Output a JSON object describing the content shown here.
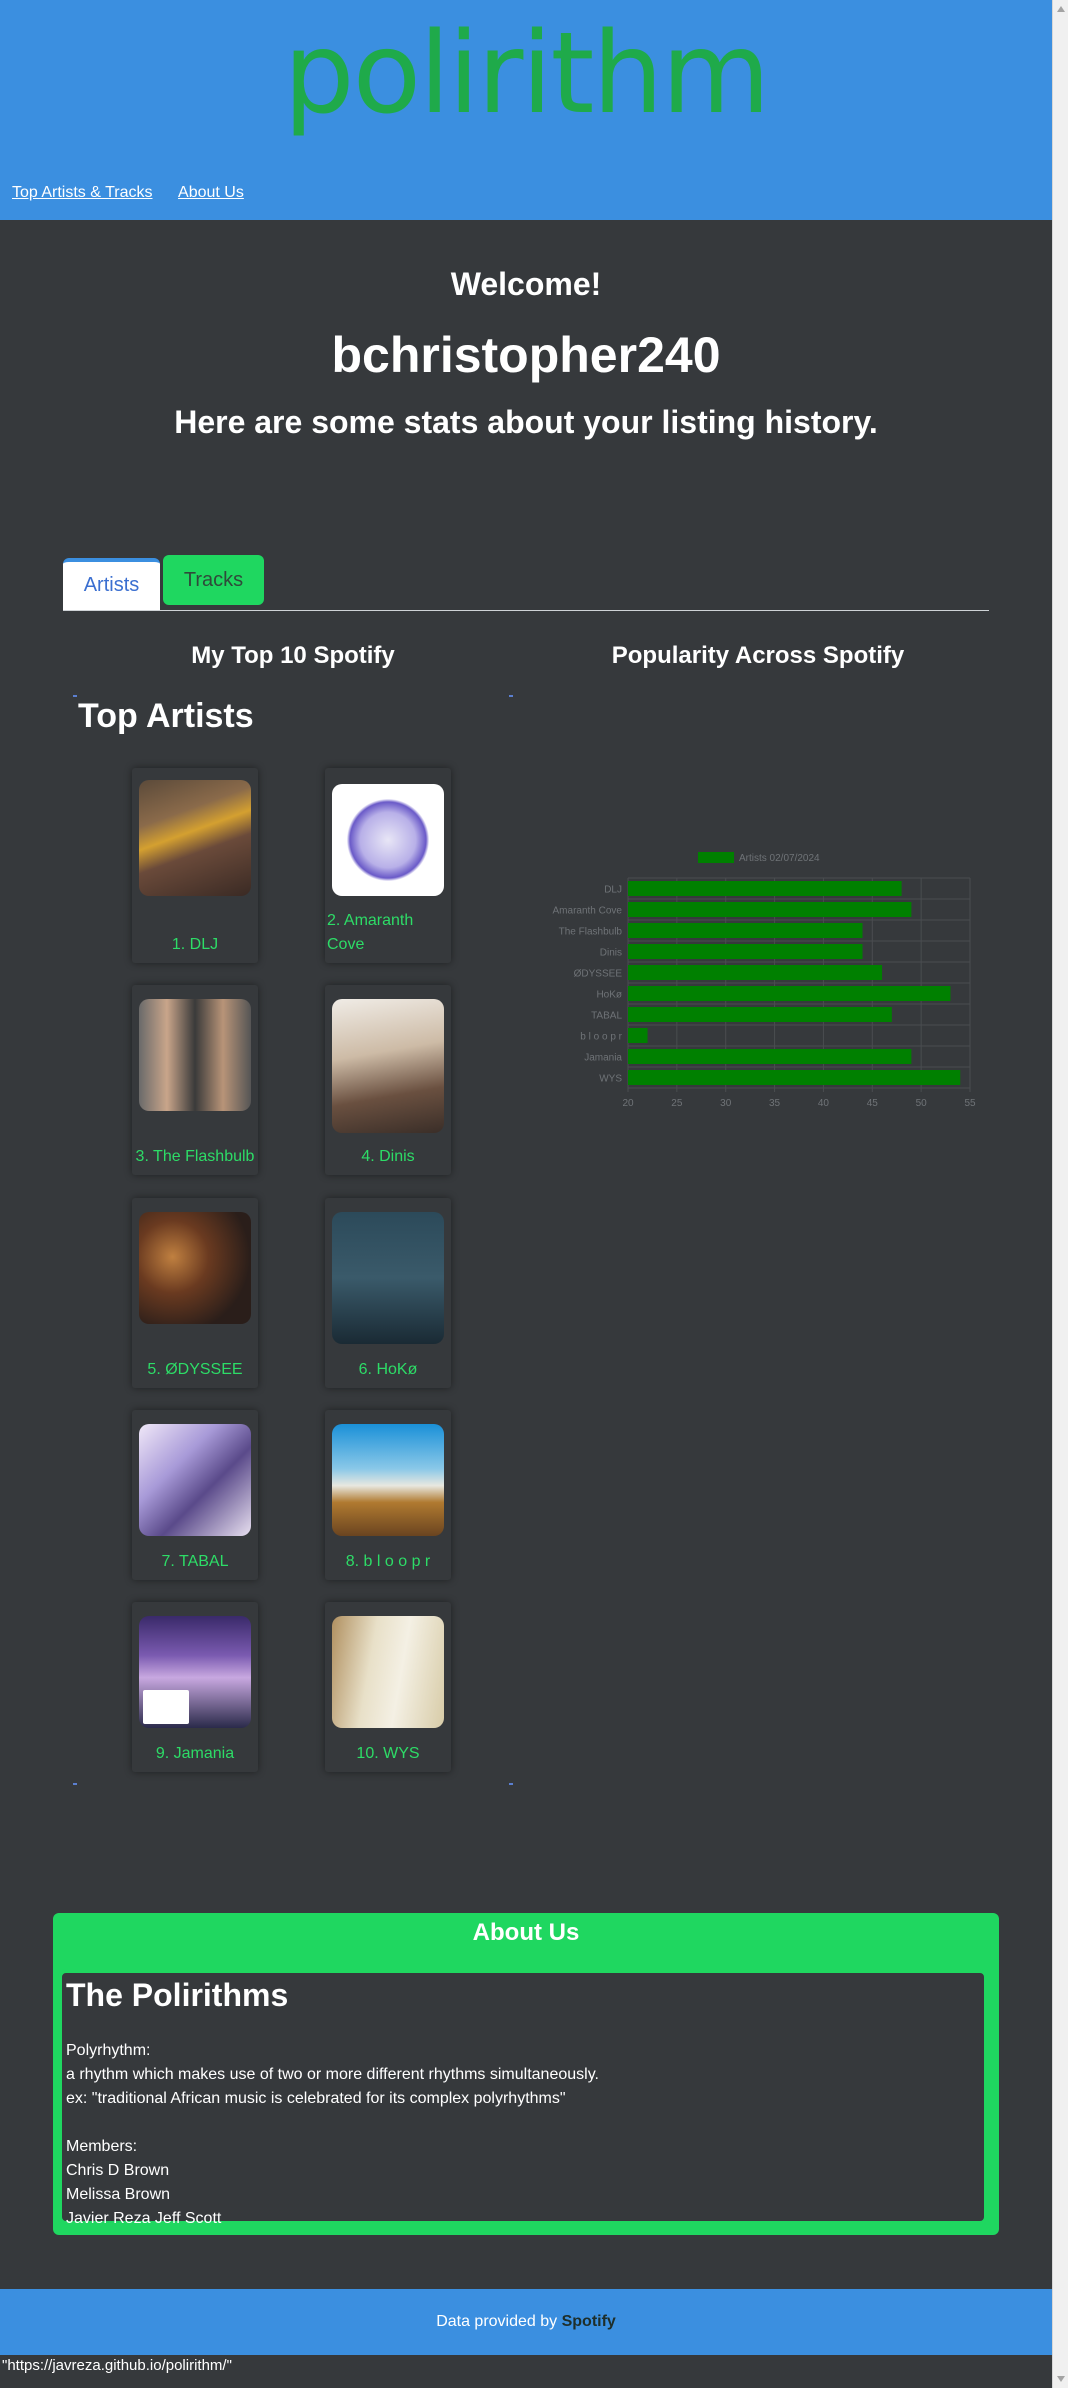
{
  "header": {
    "logo_text": "polirithm",
    "nav": [
      {
        "label": "Top Artists & Tracks"
      },
      {
        "label": "About Us"
      }
    ]
  },
  "welcome": {
    "greeting": "Welcome!",
    "username": "bchristopher240",
    "subtitle": "Here are some stats about your listing history."
  },
  "tabs": [
    {
      "label": "Artists",
      "active": true
    },
    {
      "label": "Tracks",
      "active": false
    }
  ],
  "left_title": "My Top 10 Spotify",
  "right_title": "Popularity Across Spotify",
  "top_artists": {
    "heading": "Top Artists",
    "items": [
      {
        "label": "1. DLJ"
      },
      {
        "label": "2. Amaranth Cove"
      },
      {
        "label": "3. The Flashbulb"
      },
      {
        "label": "4. Dinis"
      },
      {
        "label": "5. ØDYSSEE"
      },
      {
        "label": "6. HoKø"
      },
      {
        "label": "7. TABAL"
      },
      {
        "label": "8. b l o o p r"
      },
      {
        "label": "9. Jamania"
      },
      {
        "label": "10. WYS"
      }
    ]
  },
  "chart_data": {
    "type": "bar",
    "orientation": "horizontal",
    "categories": [
      "DLJ",
      "Amaranth Cove",
      "The Flashbulb",
      "Dinis",
      "ØDYSSEE",
      "HoKø",
      "TABAL",
      "b l o o p r",
      "Jamania",
      "WYS"
    ],
    "series": [
      {
        "name": "Artists 02/07/2024",
        "values": [
          48,
          49,
          44,
          44,
          46,
          53,
          47,
          22,
          49,
          54
        ]
      }
    ],
    "xlim": [
      20,
      55
    ],
    "xticks": [
      "20",
      "25",
      "30",
      "35",
      "40",
      "45",
      "50",
      "55"
    ],
    "grid": true,
    "legend": "top",
    "color": "#008000"
  },
  "about": {
    "title": "About Us",
    "heading": "The Polirithms",
    "lines": [
      "Polyrhythm:",
      "a rhythm which makes use of two or more different rhythms simultaneously.",
      "ex: \"traditional African music is celebrated for its complex polyrhythms\"",
      "",
      "Members:",
      "Chris D Brown",
      "Melissa Brown",
      "Javier Reza Jeff Scott"
    ]
  },
  "footer": {
    "text": "Data provided by ",
    "brand": "Spotify"
  },
  "status_url": "\"https://javreza.github.io/polirithm/\"",
  "colors": {
    "header_blue": "#3b8fe0",
    "background": "#36393c",
    "green": "#1fd760",
    "label_green": "#2ddc67"
  }
}
